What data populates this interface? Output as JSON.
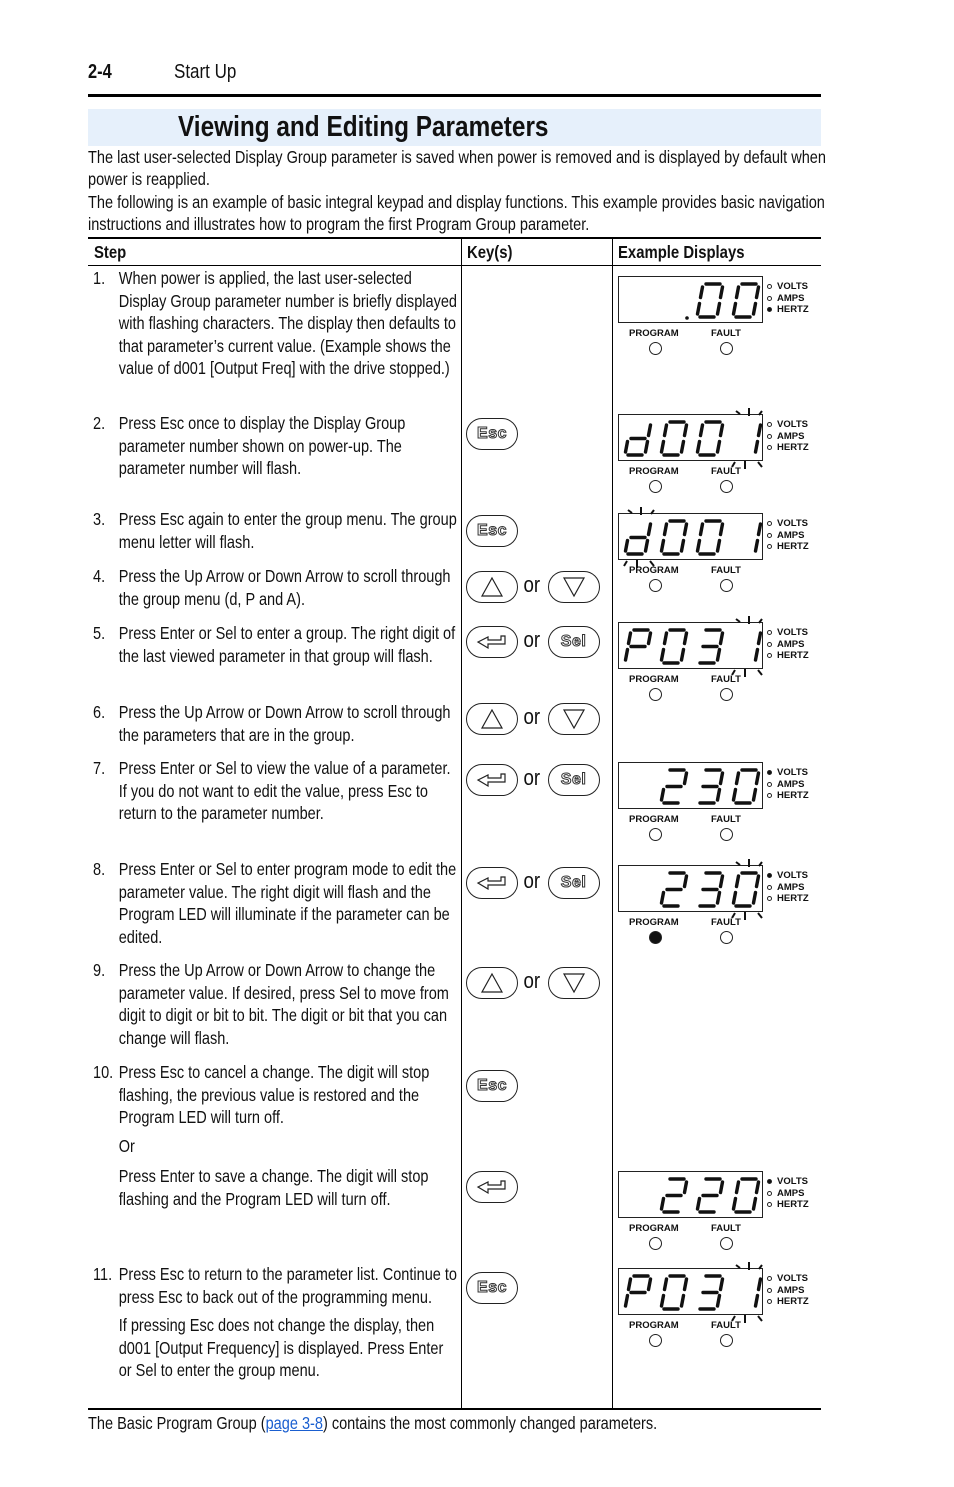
{
  "header": {
    "page_number": "2-4",
    "section": "Start Up"
  },
  "page_title": "Viewing and Editing Parameters",
  "intro": [
    "The last user-selected Display Group parameter is saved when power is removed and is displayed by default when power is reapplied.",
    "The following is an example of basic integral keypad and display functions. This example provides basic navigation instructions and illustrates how to program the first Program Group parameter."
  ],
  "table": {
    "headers": {
      "step": "Step",
      "keys": "Key(s)",
      "displays": "Example Displays"
    },
    "or_label": "or",
    "steps": [
      {
        "num": "1.",
        "paragraphs": [
          "When power is applied, the last user-selected Display Group parameter number is briefly displayed with flashing characters. The display then defaults to that parameter’s current value. (Example shows the value of d001 [Output Freq] with the drive stopped.)"
        ]
      },
      {
        "num": "2.",
        "paragraphs": [
          "Press Esc once to display the Display Group parameter number shown on power-up. The parameter number will flash."
        ]
      },
      {
        "num": "3.",
        "paragraphs": [
          "Press Esc again to enter the group menu. The group menu letter will flash."
        ]
      },
      {
        "num": "4.",
        "paragraphs": [
          "Press the Up Arrow or Down Arrow to scroll through the group menu (d, P and A)."
        ]
      },
      {
        "num": "5.",
        "paragraphs": [
          "Press Enter or Sel to enter a group. The right digit of the last viewed parameter in that group will flash."
        ]
      },
      {
        "num": "6.",
        "paragraphs": [
          "Press the Up Arrow or Down Arrow to scroll through the parameters that are in the group."
        ]
      },
      {
        "num": "7.",
        "paragraphs": [
          "Press Enter or Sel to view the value of a parameter. If you do not want to edit the value, press Esc to return to the parameter number."
        ]
      },
      {
        "num": "8.",
        "paragraphs": [
          "Press Enter or Sel to enter program mode to edit the parameter value. The right digit will flash and the Program LED will illuminate if the parameter can be edited."
        ]
      },
      {
        "num": "9.",
        "paragraphs": [
          "Press the Up Arrow or Down Arrow to change the parameter value. If desired, press Sel to move from digit to digit or bit to bit. The digit or bit that you can change will flash."
        ]
      },
      {
        "num": "10.",
        "paragraphs": [
          "Press Esc to cancel a change. The digit will stop flashing, the previous value is restored and the Program LED will turn off.",
          "Or",
          "Press Enter to save a change. The digit will stop flashing and the Program LED will turn off."
        ]
      },
      {
        "num": "11.",
        "paragraphs": [
          "Press Esc to return to the parameter list. Continue to press Esc to back out of the programming menu.",
          "If pressing Esc does not change the display, then d001 [Output Frequency] is displayed. Press Enter or Sel to enter the group menu."
        ]
      }
    ],
    "keys": {
      "esc": "Esc",
      "sel": "Sel"
    },
    "displays": [
      {
        "digits": "  00",
        "decimal_after": 2,
        "flash": -1,
        "units": "HERTZ",
        "program_led": false
      },
      {
        "digits": "d001",
        "flash": 3,
        "units": "none",
        "program_led": false
      },
      {
        "digits": "d001",
        "flash": 0,
        "units": "none",
        "program_led": false
      },
      {
        "digits": "P031",
        "flash": 3,
        "units": "none",
        "program_led": false
      },
      {
        "digits": " 230",
        "flash": -1,
        "units": "VOLTS",
        "program_led": false
      },
      {
        "digits": " 230",
        "flash": 3,
        "units": "VOLTS",
        "program_led": true
      },
      {
        "digits": " 220",
        "flash": -1,
        "units": "VOLTS",
        "program_led": false
      },
      {
        "digits": "P031",
        "flash": 3,
        "units": "none",
        "program_led": false
      }
    ],
    "unit_labels": [
      "VOLTS",
      "AMPS",
      "HERTZ"
    ],
    "led_labels": {
      "program": "PROGRAM",
      "fault": "FAULT"
    }
  },
  "footer": {
    "before": "The Basic Program Group (",
    "link": "page 3-8",
    "after": ") contains the most commonly changed parameters."
  }
}
